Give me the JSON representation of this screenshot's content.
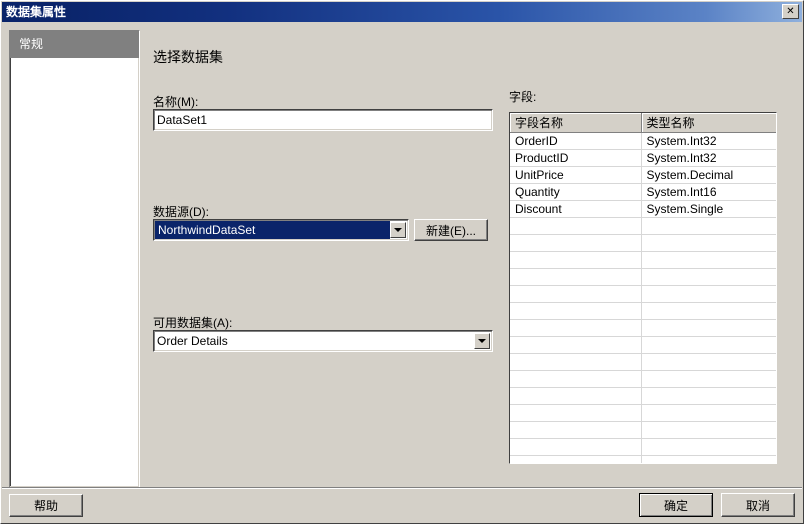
{
  "window": {
    "title": "数据集属性",
    "close_icon": "close-x-icon"
  },
  "sidebar": {
    "items": [
      {
        "label": "常规",
        "selected": true
      }
    ]
  },
  "main": {
    "heading": "选择数据集",
    "name": {
      "label": "名称(M):",
      "value": "DataSet1",
      "placeholder": ""
    },
    "datasource": {
      "label": "数据源(D):",
      "value": "NorthwindDataSet",
      "selected": true,
      "dropdown_icon": "chevron-down-icon",
      "new_button": "新建(E)..."
    },
    "available_dataset": {
      "label": "可用数据集(A):",
      "value": "Order Details",
      "dropdown_icon": "chevron-down-icon"
    },
    "fields": {
      "label": "字段:",
      "columns": [
        "字段名称",
        "类型名称"
      ],
      "rows": [
        [
          "OrderID",
          "System.Int32"
        ],
        [
          "ProductID",
          "System.Int32"
        ],
        [
          "UnitPrice",
          "System.Decimal"
        ],
        [
          "Quantity",
          "System.Int16"
        ],
        [
          "Discount",
          "System.Single"
        ]
      ],
      "empty_row_count": 15
    }
  },
  "footer": {
    "help": "帮助",
    "ok": "确定",
    "cancel": "取消"
  },
  "colors": {
    "dialog_bg": "#d4d0c8",
    "title_start": "#0a246a",
    "title_end": "#8fb0dd",
    "selection": "#0a246a",
    "nav_selected_bg": "#808080"
  }
}
